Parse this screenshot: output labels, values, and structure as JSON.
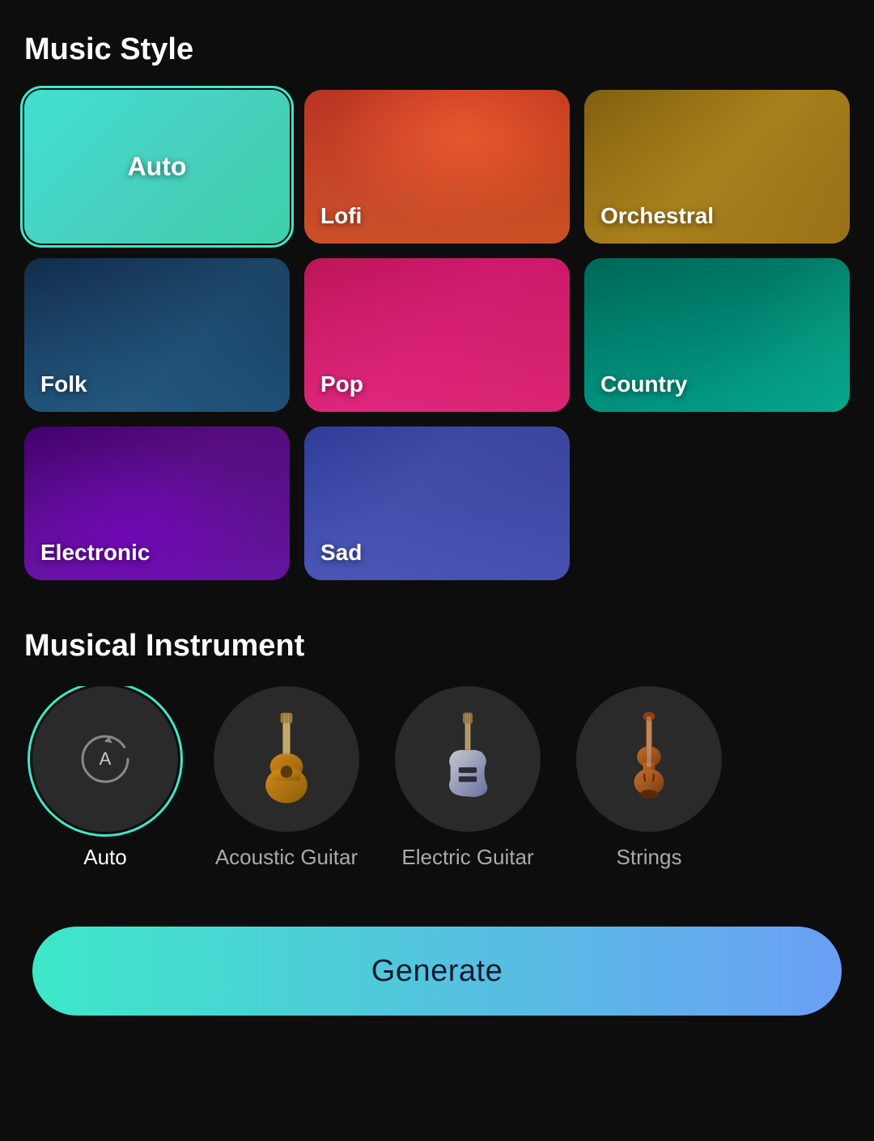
{
  "page": {
    "background": "#0d0d0d"
  },
  "musicStyle": {
    "title": "Music Style",
    "cards": [
      {
        "id": "auto",
        "label": "Auto",
        "selected": true,
        "colorClass": "card-auto"
      },
      {
        "id": "lofi",
        "label": "Lofi",
        "selected": false,
        "colorClass": "card-lofi"
      },
      {
        "id": "orchestral",
        "label": "Orchestral",
        "selected": false,
        "colorClass": "card-orchestral"
      },
      {
        "id": "folk",
        "label": "Folk",
        "selected": false,
        "colorClass": "card-folk"
      },
      {
        "id": "pop",
        "label": "Pop",
        "selected": false,
        "colorClass": "card-pop"
      },
      {
        "id": "country",
        "label": "Country",
        "selected": false,
        "colorClass": "card-country"
      },
      {
        "id": "electronic",
        "label": "Electronic",
        "selected": false,
        "colorClass": "card-electronic"
      },
      {
        "id": "sad",
        "label": "Sad",
        "selected": false,
        "colorClass": "card-sad"
      }
    ]
  },
  "musicalInstrument": {
    "title": "Musical Instrument",
    "items": [
      {
        "id": "auto",
        "label": "Auto",
        "selected": true,
        "type": "auto"
      },
      {
        "id": "acoustic-guitar",
        "label": "Acoustic Guitar",
        "selected": false,
        "type": "acoustic"
      },
      {
        "id": "electric-guitar",
        "label": "Electric Guitar",
        "selected": false,
        "type": "electric"
      },
      {
        "id": "strings",
        "label": "Strings",
        "selected": false,
        "type": "strings"
      }
    ]
  },
  "generateButton": {
    "label": "Generate"
  }
}
